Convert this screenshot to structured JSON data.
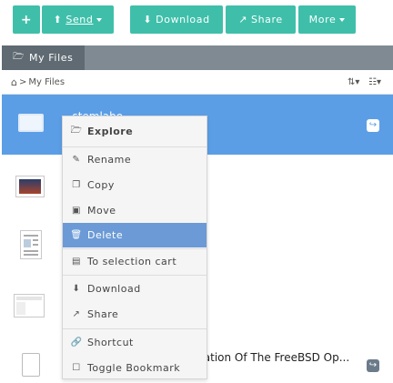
{
  "toolbar": {
    "add_icon": "plus-icon",
    "send_label": "Send",
    "download_label": "Download",
    "share_label": "Share",
    "more_label": "More"
  },
  "tabs": [
    {
      "label": "My Files"
    }
  ],
  "breadcrumb": {
    "home_icon": "home-icon",
    "separator": ">",
    "label": "My Files"
  },
  "files": [
    {
      "name": "...stemlabo",
      "selected": true
    },
    {
      "name": ""
    },
    {
      "name": ""
    },
    {
      "name": ""
    },
    {
      "name": "...ntation Of The FreeBSD Op..."
    }
  ],
  "context_menu": {
    "items": [
      {
        "label": "Explore",
        "icon": "folder-open-icon"
      },
      {
        "label": "Rename",
        "icon": "pencil-icon"
      },
      {
        "label": "Copy",
        "icon": "copy-icon"
      },
      {
        "label": "Move",
        "icon": "move-icon"
      },
      {
        "label": "Delete",
        "icon": "trash-icon",
        "active": true
      },
      {
        "label": "To selection cart",
        "icon": "basket-icon"
      },
      {
        "label": "Download",
        "icon": "download-icon"
      },
      {
        "label": "Share",
        "icon": "share-icon"
      },
      {
        "label": "Shortcut",
        "icon": "link-icon"
      },
      {
        "label": "Toggle Bookmark",
        "icon": "bookmark-icon"
      }
    ]
  },
  "colors": {
    "accent": "#3fbfaa",
    "selection": "#5b9ee6",
    "menu_active": "#6b9ad6"
  }
}
